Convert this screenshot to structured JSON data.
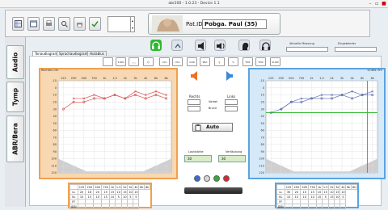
{
  "window": {
    "title": "abr200 - 1.0.23 - Device 1.1"
  },
  "toolbar": {
    "buttons": [
      "grid-icon",
      "calendar-icon",
      "printer-icon",
      "search-icon",
      "print-icon",
      "check-icon"
    ],
    "patient_label": "Pat.ID:",
    "patient_name": "Pobga. Paul (35)"
  },
  "side_tabs": [
    "Audio",
    "Tymp",
    "ABR/Bera"
  ],
  "sub_tabs": [
    "Tonaudiogramm",
    "Sprachaudiogramm",
    "Hutablus"
  ],
  "top_fields": {
    "left_label": "Aktuelle Messung",
    "right_label": "Eingebender"
  },
  "right_ear": {
    "title": "Rechtes Ohr"
  },
  "left_ear": {
    "title": "Linkes Ohr"
  },
  "mid": {
    "rechts": "Rechts",
    "links": "Links",
    "label1": "Vorbei",
    "label2": "Bruce",
    "auto": "Auto",
    "lautstaerke_label": "Lautstärke",
    "lautstaerke_value": "30",
    "vertaeubung_label": "Vertäubung",
    "vertaeubung_value": "30"
  },
  "freqs": [
    "125",
    "250",
    "500",
    "750",
    "1k",
    "1.5",
    "2k",
    "3k",
    "4k",
    "6k",
    "8k"
  ],
  "y_ticks": [
    "-10",
    "0",
    "10",
    "20",
    "30",
    "40",
    "50",
    "60",
    "70",
    "80",
    "90",
    "100",
    "110",
    "120"
  ],
  "chart_data": [
    {
      "type": "line",
      "title": "Rechtes Ohr",
      "x": [
        "125",
        "250",
        "500",
        "750",
        "1k",
        "1.5",
        "2k",
        "3k",
        "4k",
        "6k",
        "8k"
      ],
      "ylim": [
        -10,
        120
      ],
      "series": [
        {
          "values": [
            30,
            20,
            20,
            15,
            15,
            10,
            15,
            10,
            15,
            10,
            15
          ]
        },
        {
          "values": [
            null,
            15,
            15,
            10,
            15,
            10,
            15,
            5,
            10,
            5,
            10
          ]
        }
      ]
    },
    {
      "type": "line",
      "title": "Linkes Ohr",
      "x": [
        "125",
        "250",
        "500",
        "750",
        "1k",
        "1.5",
        "2k",
        "3k",
        "4k",
        "6k",
        "8k"
      ],
      "ylim": [
        -10,
        120
      ],
      "series": [
        {
          "values": [
            35,
            30,
            20,
            20,
            15,
            15,
            15,
            10,
            15,
            10,
            10
          ]
        },
        {
          "values": [
            null,
            30,
            20,
            15,
            15,
            10,
            10,
            10,
            5,
            10,
            5
          ]
        }
      ]
    }
  ],
  "table_right": {
    "rows": [
      [
        "125",
        "250",
        "500",
        "750",
        "1k",
        "1.5",
        "2k",
        "3k",
        "4k",
        "6k",
        "8k"
      ],
      [
        "LL",
        "20",
        "18",
        "20",
        "15",
        "15",
        "10",
        "15",
        "10",
        "15"
      ],
      [
        "KL",
        "15",
        "15",
        "10",
        "15",
        "10",
        "5",
        "10",
        "5",
        "5"
      ],
      [
        "FF",
        "",
        "",
        "",
        "",
        "",
        "",
        "",
        "",
        ""
      ],
      [
        "SISI",
        "",
        "",
        "",
        "",
        "",
        "",
        "",
        "",
        ""
      ]
    ]
  },
  "table_left": {
    "rows": [
      [
        "125",
        "250",
        "500",
        "750",
        "1k",
        "1.5",
        "2k",
        "3k",
        "4k",
        "6k",
        "8k"
      ],
      [
        "LL",
        "30",
        "20",
        "15",
        "15",
        "10",
        "15",
        "10",
        "15",
        "10"
      ],
      [
        "KL",
        "15",
        "15",
        "10",
        "10",
        "10",
        "5",
        "15",
        "10",
        "5"
      ],
      [
        "FF",
        "",
        "",
        "",
        "",
        "",
        "",
        "",
        "",
        ""
      ],
      [
        "SISI",
        "",
        "",
        "",
        "",
        "",
        "",
        "",
        "",
        ""
      ]
    ]
  },
  "colors": {
    "right_ear": "#e05050",
    "left_ear": "#5a6fb0",
    "green": "#33bb33"
  }
}
